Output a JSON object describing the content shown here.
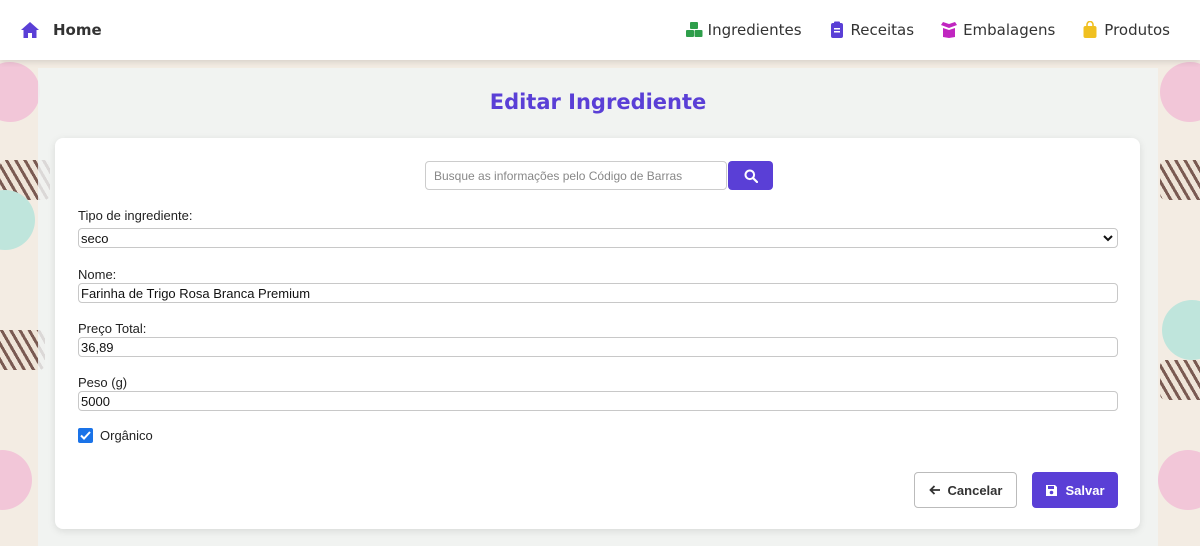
{
  "navbar": {
    "home_label": "Home",
    "links": [
      {
        "label": "Ingredientes",
        "icon": "cubes-icon",
        "color": "#2e9e4a"
      },
      {
        "label": "Receitas",
        "icon": "clipboard-icon",
        "color": "#5a3fd6"
      },
      {
        "label": "Embalagens",
        "icon": "box-open-icon",
        "color": "#c026c0"
      },
      {
        "label": "Produtos",
        "icon": "shopping-bag-icon",
        "color": "#f0c020"
      }
    ]
  },
  "page": {
    "title": "Editar Ingrediente",
    "accent_color": "#5a3fd6"
  },
  "form": {
    "search_placeholder": "Busque as informações pelo Código de Barras",
    "tipo_label": "Tipo de ingrediente:",
    "tipo_value": "seco",
    "nome_label": "Nome:",
    "nome_value": "Farinha de Trigo Rosa Branca Premium",
    "preco_label": "Preço Total:",
    "preco_value": "36,89",
    "peso_label": "Peso (g)",
    "peso_value": "5000",
    "organico_label": "Orgânico",
    "organico_checked": true,
    "cancel_label": "Cancelar",
    "save_label": "Salvar"
  }
}
